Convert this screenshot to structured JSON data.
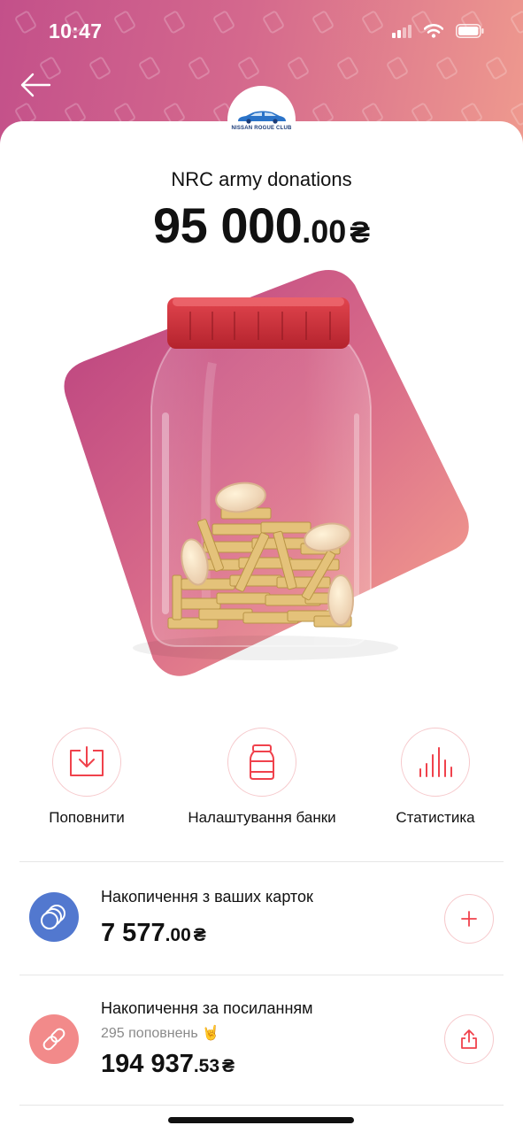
{
  "status_bar": {
    "time": "10:47"
  },
  "header": {
    "logo_text": "NISSAN ROGUE CLUB"
  },
  "jar": {
    "title": "NRC army donations",
    "amount_main": "95 000",
    "amount_fraction": ".00",
    "currency": "₴"
  },
  "actions": [
    {
      "label": "Поповнити",
      "icon": "download-tray-icon"
    },
    {
      "label": "Налаштування банки",
      "icon": "jar-icon"
    },
    {
      "label": "Статистика",
      "icon": "bar-chart-icon"
    }
  ],
  "rows": {
    "cards": {
      "title": "Накопичення з ваших карток",
      "amount_main": "7 577",
      "amount_fraction": ".00",
      "currency": "₴",
      "icon": "stacked-coins-icon",
      "button_icon": "plus-icon"
    },
    "link": {
      "title": "Накопичення за посиланням",
      "subtitle": "295 поповнень 🤘",
      "amount_main": "194 937",
      "amount_fraction": ".53",
      "currency": "₴",
      "icon": "chain-link-icon",
      "button_icon": "share-icon"
    }
  },
  "colors": {
    "accent": "#f0424c",
    "header_gradient_start": "#c3508a",
    "header_gradient_end": "#ef9a8e",
    "cards_avatar": "#5278cf",
    "link_avatar": "#f28a8a"
  }
}
